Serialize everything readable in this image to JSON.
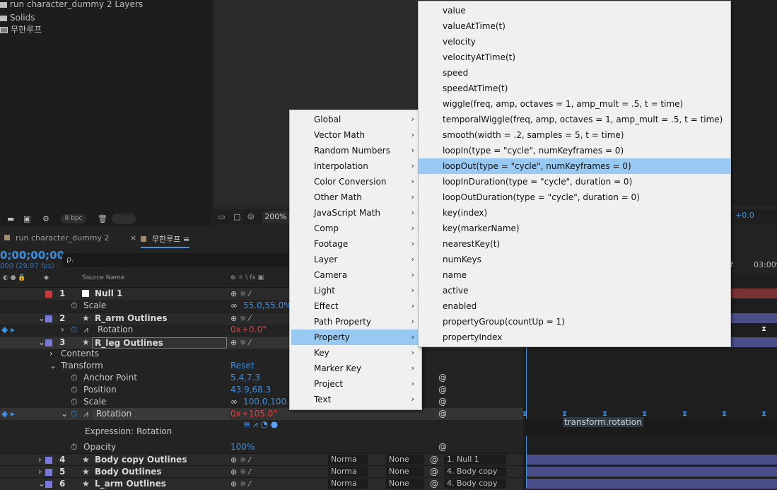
{
  "project": {
    "items": [
      {
        "label": "run character_dummy 2 Layers",
        "icon": "folder-icon"
      },
      {
        "label": "Solids",
        "icon": "folder-icon"
      },
      {
        "label": "무한루프",
        "icon": "composition-icon"
      }
    ],
    "bpc": "8 bpc"
  },
  "viewer": {
    "zoom": "200%",
    "exposure": "+0.0"
  },
  "timeline": {
    "tabs": [
      "run character_dummy 2",
      "무한루프"
    ],
    "timecode": "0;00;00;00",
    "fps": "000 (29.97 fps)",
    "search_placeholder": "ρ.",
    "header_source_name": "Source Name",
    "ruler_label_1": "f",
    "ruler_label_2": "03:00f",
    "rows": [
      {
        "num": "1",
        "name": "Null 1",
        "color": "#c83a3a"
      },
      {
        "prop": "Scale",
        "value": "55.0,55.0%"
      },
      {
        "num": "2",
        "name": "R_arm Outlines",
        "color": "#7878d8"
      },
      {
        "prop": "Rotation",
        "value_prefix": "0x",
        "value": "+0.0°"
      },
      {
        "num": "3",
        "name": "R_leg Outlines",
        "color": "#7878d8"
      },
      {
        "prop": "Contents"
      },
      {
        "prop": "Transform",
        "value": "Reset"
      },
      {
        "prop": "Anchor Point",
        "value": "5.4,7.3"
      },
      {
        "prop": "Position",
        "value": "43.9,68.3"
      },
      {
        "prop": "Scale",
        "value": "100.0,100.0"
      },
      {
        "prop": "Rotation",
        "value_prefix": "0x",
        "value": "+105.0°"
      },
      {
        "prop": "Expression: Rotation"
      },
      {
        "prop": "Opacity",
        "value": "100%"
      },
      {
        "num": "4",
        "name": "Body copy Outlines",
        "color": "#7878d8",
        "mode": "Norma",
        "trkmat": "None",
        "parent": "1. Null 1"
      },
      {
        "num": "5",
        "name": "Body Outlines",
        "color": "#7878d8",
        "mode": "Norma",
        "trkmat": "None",
        "parent": "4. Body copy"
      },
      {
        "num": "6",
        "name": "L_arm Outlines",
        "color": "#7878d8",
        "mode": "Norma",
        "trkmat": "None",
        "parent": "4. Body copy"
      }
    ],
    "expression_text": "transform.rotation"
  },
  "expression_menu": {
    "items": [
      "Global",
      "Vector Math",
      "Random Numbers",
      "Interpolation",
      "Color Conversion",
      "Other Math",
      "JavaScript Math",
      "Comp",
      "Footage",
      "Layer",
      "Camera",
      "Light",
      "Effect",
      "Path Property",
      "Property",
      "Key",
      "Marker Key",
      "Project",
      "Text"
    ],
    "highlighted": "Property"
  },
  "property_submenu": {
    "items": [
      "value",
      "valueAtTime(t)",
      "velocity",
      "velocityAtTime(t)",
      "speed",
      "speedAtTime(t)",
      "wiggle(freq, amp, octaves = 1, amp_mult = .5, t = time)",
      "temporalWiggle(freq, amp, octaves = 1, amp_mult = .5, t = time)",
      "smooth(width = .2, samples = 5, t = time)",
      "loopIn(type = \"cycle\", numKeyframes = 0)",
      "loopOut(type = \"cycle\", numKeyframes = 0)",
      "loopInDuration(type = \"cycle\", duration = 0)",
      "loopOutDuration(type = \"cycle\", duration = 0)",
      "key(index)",
      "key(markerName)",
      "nearestKey(t)",
      "numKeys",
      "name",
      "active",
      "enabled",
      "propertyGroup(countUp = 1)",
      "propertyIndex"
    ],
    "highlighted": "loopOut(type = \"cycle\", numKeyframes = 0)"
  },
  "colors": {
    "accent": "#3a8fe0",
    "highlight": "#98c9f2",
    "value_red": "#e04040"
  }
}
